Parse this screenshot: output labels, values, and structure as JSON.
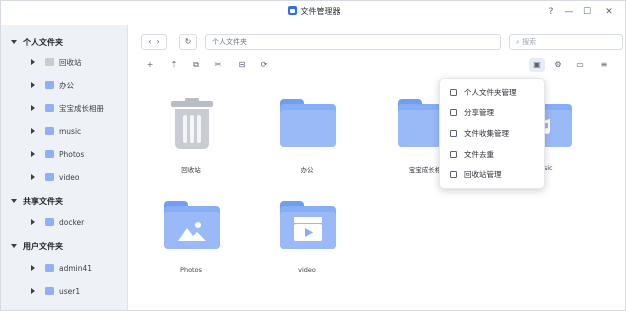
{
  "window": {
    "title": "文件管理器",
    "help_label": "?",
    "minimize_label": "—",
    "maximize_label": "☐",
    "close_label": "✕"
  },
  "sidebar": {
    "groups": [
      {
        "label": "个人文件夹",
        "items": [
          {
            "label": "回收站",
            "icon": "trash-icon"
          },
          {
            "label": "办公",
            "icon": "folder-icon"
          },
          {
            "label": "宝宝成长相册",
            "icon": "folder-icon"
          },
          {
            "label": "music",
            "icon": "folder-icon"
          },
          {
            "label": "Photos",
            "icon": "folder-icon"
          },
          {
            "label": "video",
            "icon": "folder-icon"
          }
        ]
      },
      {
        "label": "共享文件夹",
        "items": [
          {
            "label": "docker",
            "icon": "folder-icon"
          }
        ]
      },
      {
        "label": "用户文件夹",
        "items": [
          {
            "label": "admin41",
            "icon": "folder-icon"
          },
          {
            "label": "user1",
            "icon": "folder-icon"
          }
        ]
      }
    ]
  },
  "toolbar": {
    "back": "‹",
    "forward": "›",
    "refresh": "↻",
    "path": "个人文件夹",
    "search_placeholder": "搜索",
    "new": "+",
    "upload": "⇡",
    "copy": "⧉",
    "cut": "✂",
    "compress": "⊟",
    "share": "⟳",
    "folder_tools": "▣",
    "settings": "⚙",
    "view": "▭",
    "sort": "≡"
  },
  "files": [
    {
      "label": "回收站",
      "kind": "trash"
    },
    {
      "label": "办公",
      "kind": "folder"
    },
    {
      "label": "宝宝成长相",
      "kind": "folder"
    },
    {
      "label": "music",
      "kind": "folder"
    },
    {
      "label": "Photos",
      "kind": "photos"
    },
    {
      "label": "video",
      "kind": "video"
    }
  ],
  "menu": {
    "items": [
      {
        "label": "个人文件夹管理",
        "icon": "folder-manage-icon"
      },
      {
        "label": "分享管理",
        "icon": "share-icon"
      },
      {
        "label": "文件收集管理",
        "icon": "collect-icon"
      },
      {
        "label": "文件去重",
        "icon": "dedupe-icon"
      },
      {
        "label": "回收站管理",
        "icon": "trash-icon"
      }
    ]
  },
  "colors": {
    "accent": "#2f6fe8",
    "folder": "#86aef5",
    "sidebar_bg": "#eef1f6"
  }
}
